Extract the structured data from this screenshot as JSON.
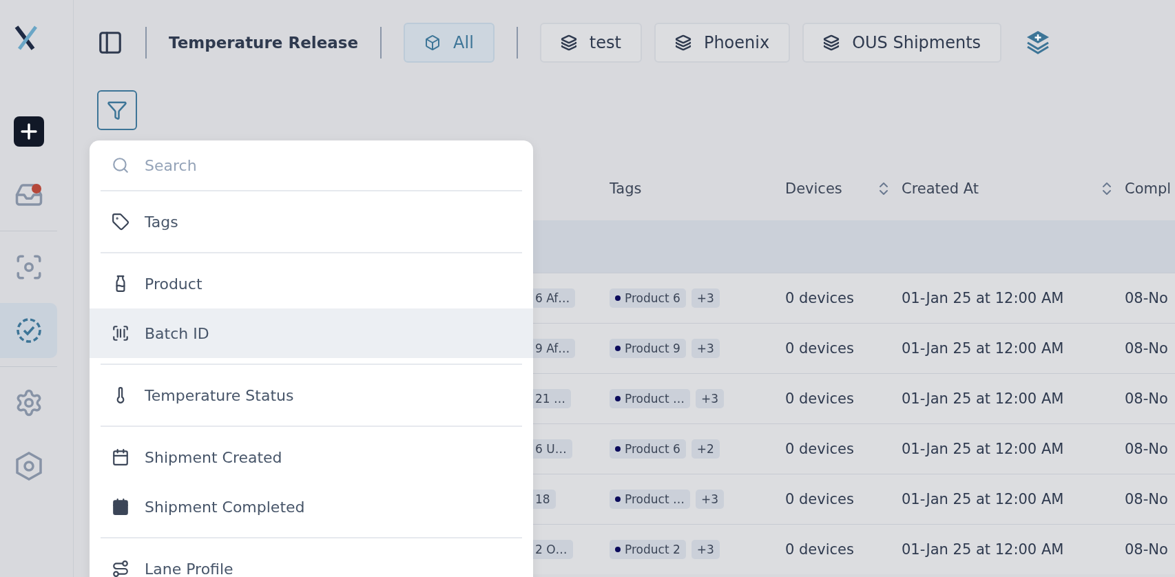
{
  "sidebar": {
    "items": [
      {
        "kind": "create",
        "selected": false,
        "badge": false
      },
      {
        "kind": "inbox",
        "selected": false,
        "badge": true
      },
      {
        "kind": "scan",
        "selected": false,
        "badge": false
      },
      {
        "kind": "release",
        "selected": true,
        "badge": false
      },
      {
        "kind": "settings",
        "selected": false,
        "badge": false
      },
      {
        "kind": "hexagon",
        "selected": false,
        "badge": false
      }
    ]
  },
  "toolbar": {
    "title": "Temperature Release",
    "views": [
      {
        "kind": "all",
        "label": "All",
        "selected": true
      },
      {
        "kind": "layer",
        "label": "test",
        "selected": false
      },
      {
        "kind": "layer",
        "label": "Phoenix",
        "selected": false
      },
      {
        "kind": "layer",
        "label": "OUS Shipments",
        "selected": false
      }
    ]
  },
  "filter_menu": {
    "search": {
      "placeholder": "Search"
    },
    "groups": [
      [
        {
          "kind": "tag",
          "label": "Tags",
          "highlighted": false
        }
      ],
      [
        {
          "kind": "bottle",
          "label": "Product",
          "highlighted": false
        },
        {
          "kind": "barcode",
          "label": "Batch ID",
          "highlighted": true
        }
      ],
      [
        {
          "kind": "thermometer",
          "label": "Temperature Status",
          "highlighted": false
        }
      ],
      [
        {
          "kind": "calendar",
          "label": "Shipment Created",
          "highlighted": false
        },
        {
          "kind": "calendar-filled",
          "label": "Shipment Completed",
          "highlighted": false
        }
      ],
      [
        {
          "kind": "route",
          "label": "Lane Profile",
          "highlighted": false
        }
      ]
    ]
  },
  "table": {
    "columns": [
      {
        "label": "Tags",
        "sortable": false
      },
      {
        "label": "Devices",
        "sortable": true
      },
      {
        "label": "Created At",
        "sortable": true
      },
      {
        "label": "Compl"
      }
    ],
    "rows": [
      {
        "column_1": "6 Af…",
        "tag": "Product 6",
        "more": "+3",
        "devices": "0 devices",
        "created_at": "01-Jan 25 at 12:00 AM",
        "column_5": "08-No"
      },
      {
        "column_1": "9 Af…",
        "tag": "Product 9",
        "more": "+3",
        "devices": "0 devices",
        "created_at": "01-Jan 25 at 12:00 AM",
        "column_5": "08-No"
      },
      {
        "column_1": "21 …",
        "tag": "Product …",
        "more": "+3",
        "devices": "0 devices",
        "created_at": "01-Jan 25 at 12:00 AM",
        "column_5": "08-No"
      },
      {
        "column_1": "6 U…",
        "tag": "Product 6",
        "more": "+2",
        "devices": "0 devices",
        "created_at": "01-Jan 25 at 12:00 AM",
        "column_5": "08-No"
      },
      {
        "column_1": "18",
        "tag": "Product …",
        "more": "+3",
        "devices": "0 devices",
        "created_at": "01-Jan 25 at 12:00 AM",
        "column_5": "08-No"
      },
      {
        "column_1": "2 O…",
        "tag": "Product 2",
        "more": "+3",
        "devices": "0 devices",
        "created_at": "01-Jan 25 at 12:00 AM",
        "column_5": "08-No"
      }
    ]
  }
}
